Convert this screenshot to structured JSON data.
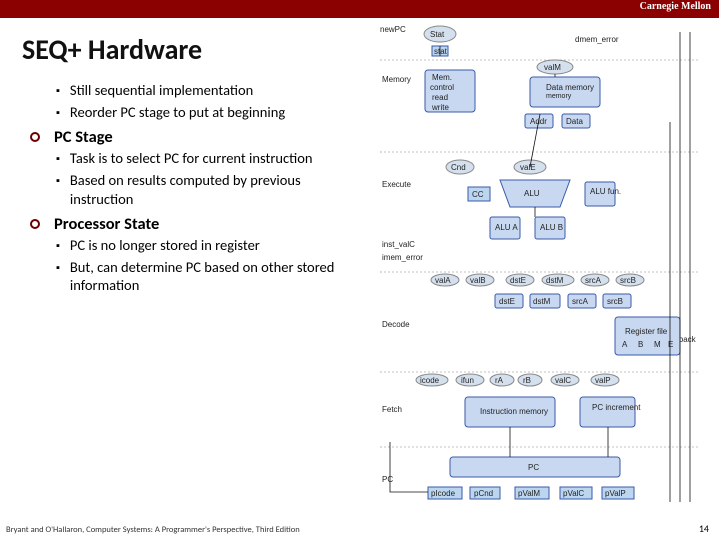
{
  "header": {
    "org": "Carnegie Mellon"
  },
  "title": "SEQ+ Hardware",
  "intro_bullets": [
    "Still sequential implementation",
    "Reorder PC stage to put at beginning"
  ],
  "sections": [
    {
      "heading": "PC Stage",
      "bullets": [
        "Task is to select PC for current instruction",
        "Based on results computed by previous instruction"
      ]
    },
    {
      "heading": "Processor State",
      "bullets": [
        "PC is no longer stored in register",
        "But, can determine PC based on other stored information"
      ]
    }
  ],
  "footer": "Bryant and O'Hallaron, Computer Systems: A Programmer's Perspective, Third Edition",
  "page": "14",
  "diagram": {
    "stages": [
      "Memory",
      "Execute",
      "Decode",
      "Write back",
      "Fetch",
      "PC"
    ],
    "side_signals": [
      "newPC",
      "stat",
      "inst_valC",
      "imem_error"
    ],
    "top_signals": [
      "Stat",
      "stat",
      "dmem_error"
    ],
    "mem_box": [
      "Mem.",
      "control",
      "read",
      "write"
    ],
    "data_mem": "Data memory",
    "mem_ports": [
      "Addr",
      "Data"
    ],
    "valM": "valM",
    "cnd": "Cnd",
    "valE": "valE",
    "cc": "CC",
    "alu": "ALU",
    "alu_fun": "ALU fun.",
    "alu_ab": [
      "ALU A",
      "ALU B"
    ],
    "decode_vals": [
      "valA",
      "valB",
      "dstE",
      "dstM",
      "srcA",
      "srcB"
    ],
    "decode_boxes": [
      "dstE",
      "dstM",
      "srcA",
      "srcB"
    ],
    "regfile": "Register file",
    "regfile_ports": [
      "A",
      "B",
      "M",
      "E"
    ],
    "fetch_vals": [
      "icode",
      "ifun",
      "rA",
      "rB",
      "valC",
      "valP"
    ],
    "instr_mem": "Instruction memory",
    "pc_inc": "PC increment",
    "pc_block": "PC",
    "pc_inputs": [
      "pIcode",
      "pCnd",
      "pValM",
      "pValC",
      "pValP"
    ]
  }
}
